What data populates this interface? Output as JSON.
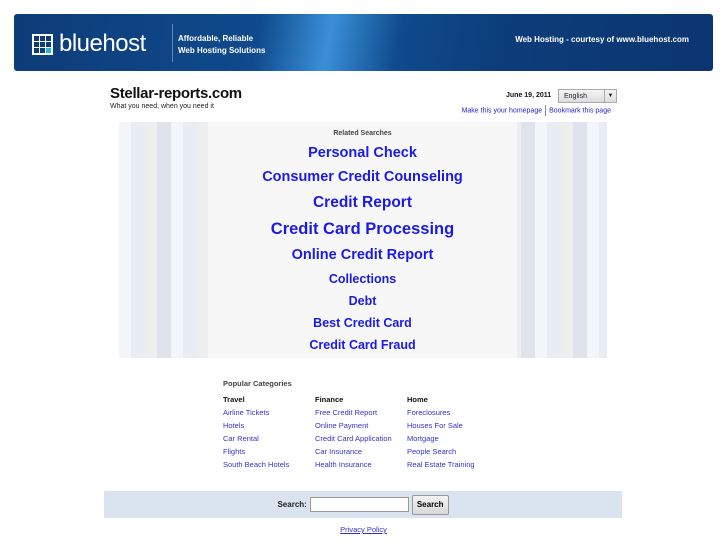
{
  "banner": {
    "brand": "bluehost",
    "brand_light": "blue",
    "brand_bold": "host",
    "tagline_1": "Affordable, Reliable",
    "tagline_2": "Web Hosting Solutions",
    "courtesy": "Web Hosting - courtesy of www.bluehost.com"
  },
  "header": {
    "site_title": "Stellar-reports.com",
    "subtitle": "What you need, when you need it",
    "date": "June 19, 2011",
    "language": "English",
    "make_homepage": "Make this your homepage",
    "bookmark": "Bookmark this page"
  },
  "related": {
    "label": "Related Searches",
    "links": [
      "Personal Check",
      "Consumer Credit Counseling",
      "Credit Report",
      "Credit Card Processing",
      "Online Credit Report",
      "Collections",
      "Debt",
      "Best Credit Card",
      "Credit Card Fraud"
    ]
  },
  "categories": {
    "title": "Popular Categories",
    "columns": [
      {
        "heading": "Travel",
        "links": [
          "Airline Tickets",
          "Hotels",
          "Car Rental",
          "Flights",
          "South Beach Hotels"
        ]
      },
      {
        "heading": "Finance",
        "links": [
          "Free Credit Report",
          "Online Payment",
          "Credit Card Application",
          "Car Insurance",
          "Health Insurance"
        ]
      },
      {
        "heading": "Home",
        "links": [
          "Foreclosures",
          "Houses For Sale",
          "Mortgage",
          "People Search",
          "Real Estate Training"
        ]
      }
    ]
  },
  "search": {
    "label": "Search:",
    "value": "",
    "button": "Search"
  },
  "footer": {
    "privacy": "Privacy Policy"
  },
  "colors": {
    "banner": "#0d3c78",
    "link": "#1a1ae6",
    "search_bar": "#d9e4f0"
  }
}
